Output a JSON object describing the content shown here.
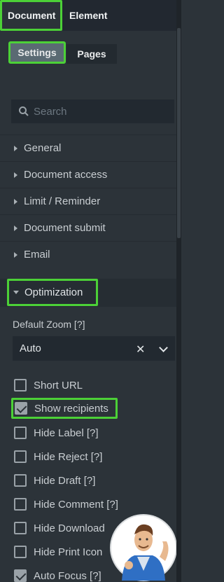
{
  "top_tabs": [
    {
      "label": "Document"
    },
    {
      "label": "Element"
    }
  ],
  "sub_tabs": [
    {
      "label": "Settings"
    },
    {
      "label": "Pages"
    }
  ],
  "search": {
    "placeholder": "Search"
  },
  "sections": [
    {
      "label": "General"
    },
    {
      "label": "Document access"
    },
    {
      "label": "Limit / Reminder"
    },
    {
      "label": "Document submit"
    },
    {
      "label": "Email"
    }
  ],
  "open_section": {
    "label": "Optimization"
  },
  "zoom": {
    "label": "Default Zoom [?]",
    "value": "Auto"
  },
  "options": [
    {
      "label": "Short URL",
      "checked": false
    },
    {
      "label": "Show recipients",
      "checked": true
    },
    {
      "label": "Hide Label [?]",
      "checked": false
    },
    {
      "label": "Hide Reject [?]",
      "checked": false
    },
    {
      "label": "Hide Draft [?]",
      "checked": false
    },
    {
      "label": "Hide Comment [?]",
      "checked": false
    },
    {
      "label": "Hide Download",
      "checked": false
    },
    {
      "label": "Hide Print Icon",
      "checked": false
    },
    {
      "label": "Auto Focus [?]",
      "checked": true
    }
  ],
  "colors": {
    "highlight": "#4cd137",
    "panel": "#2c3339"
  }
}
